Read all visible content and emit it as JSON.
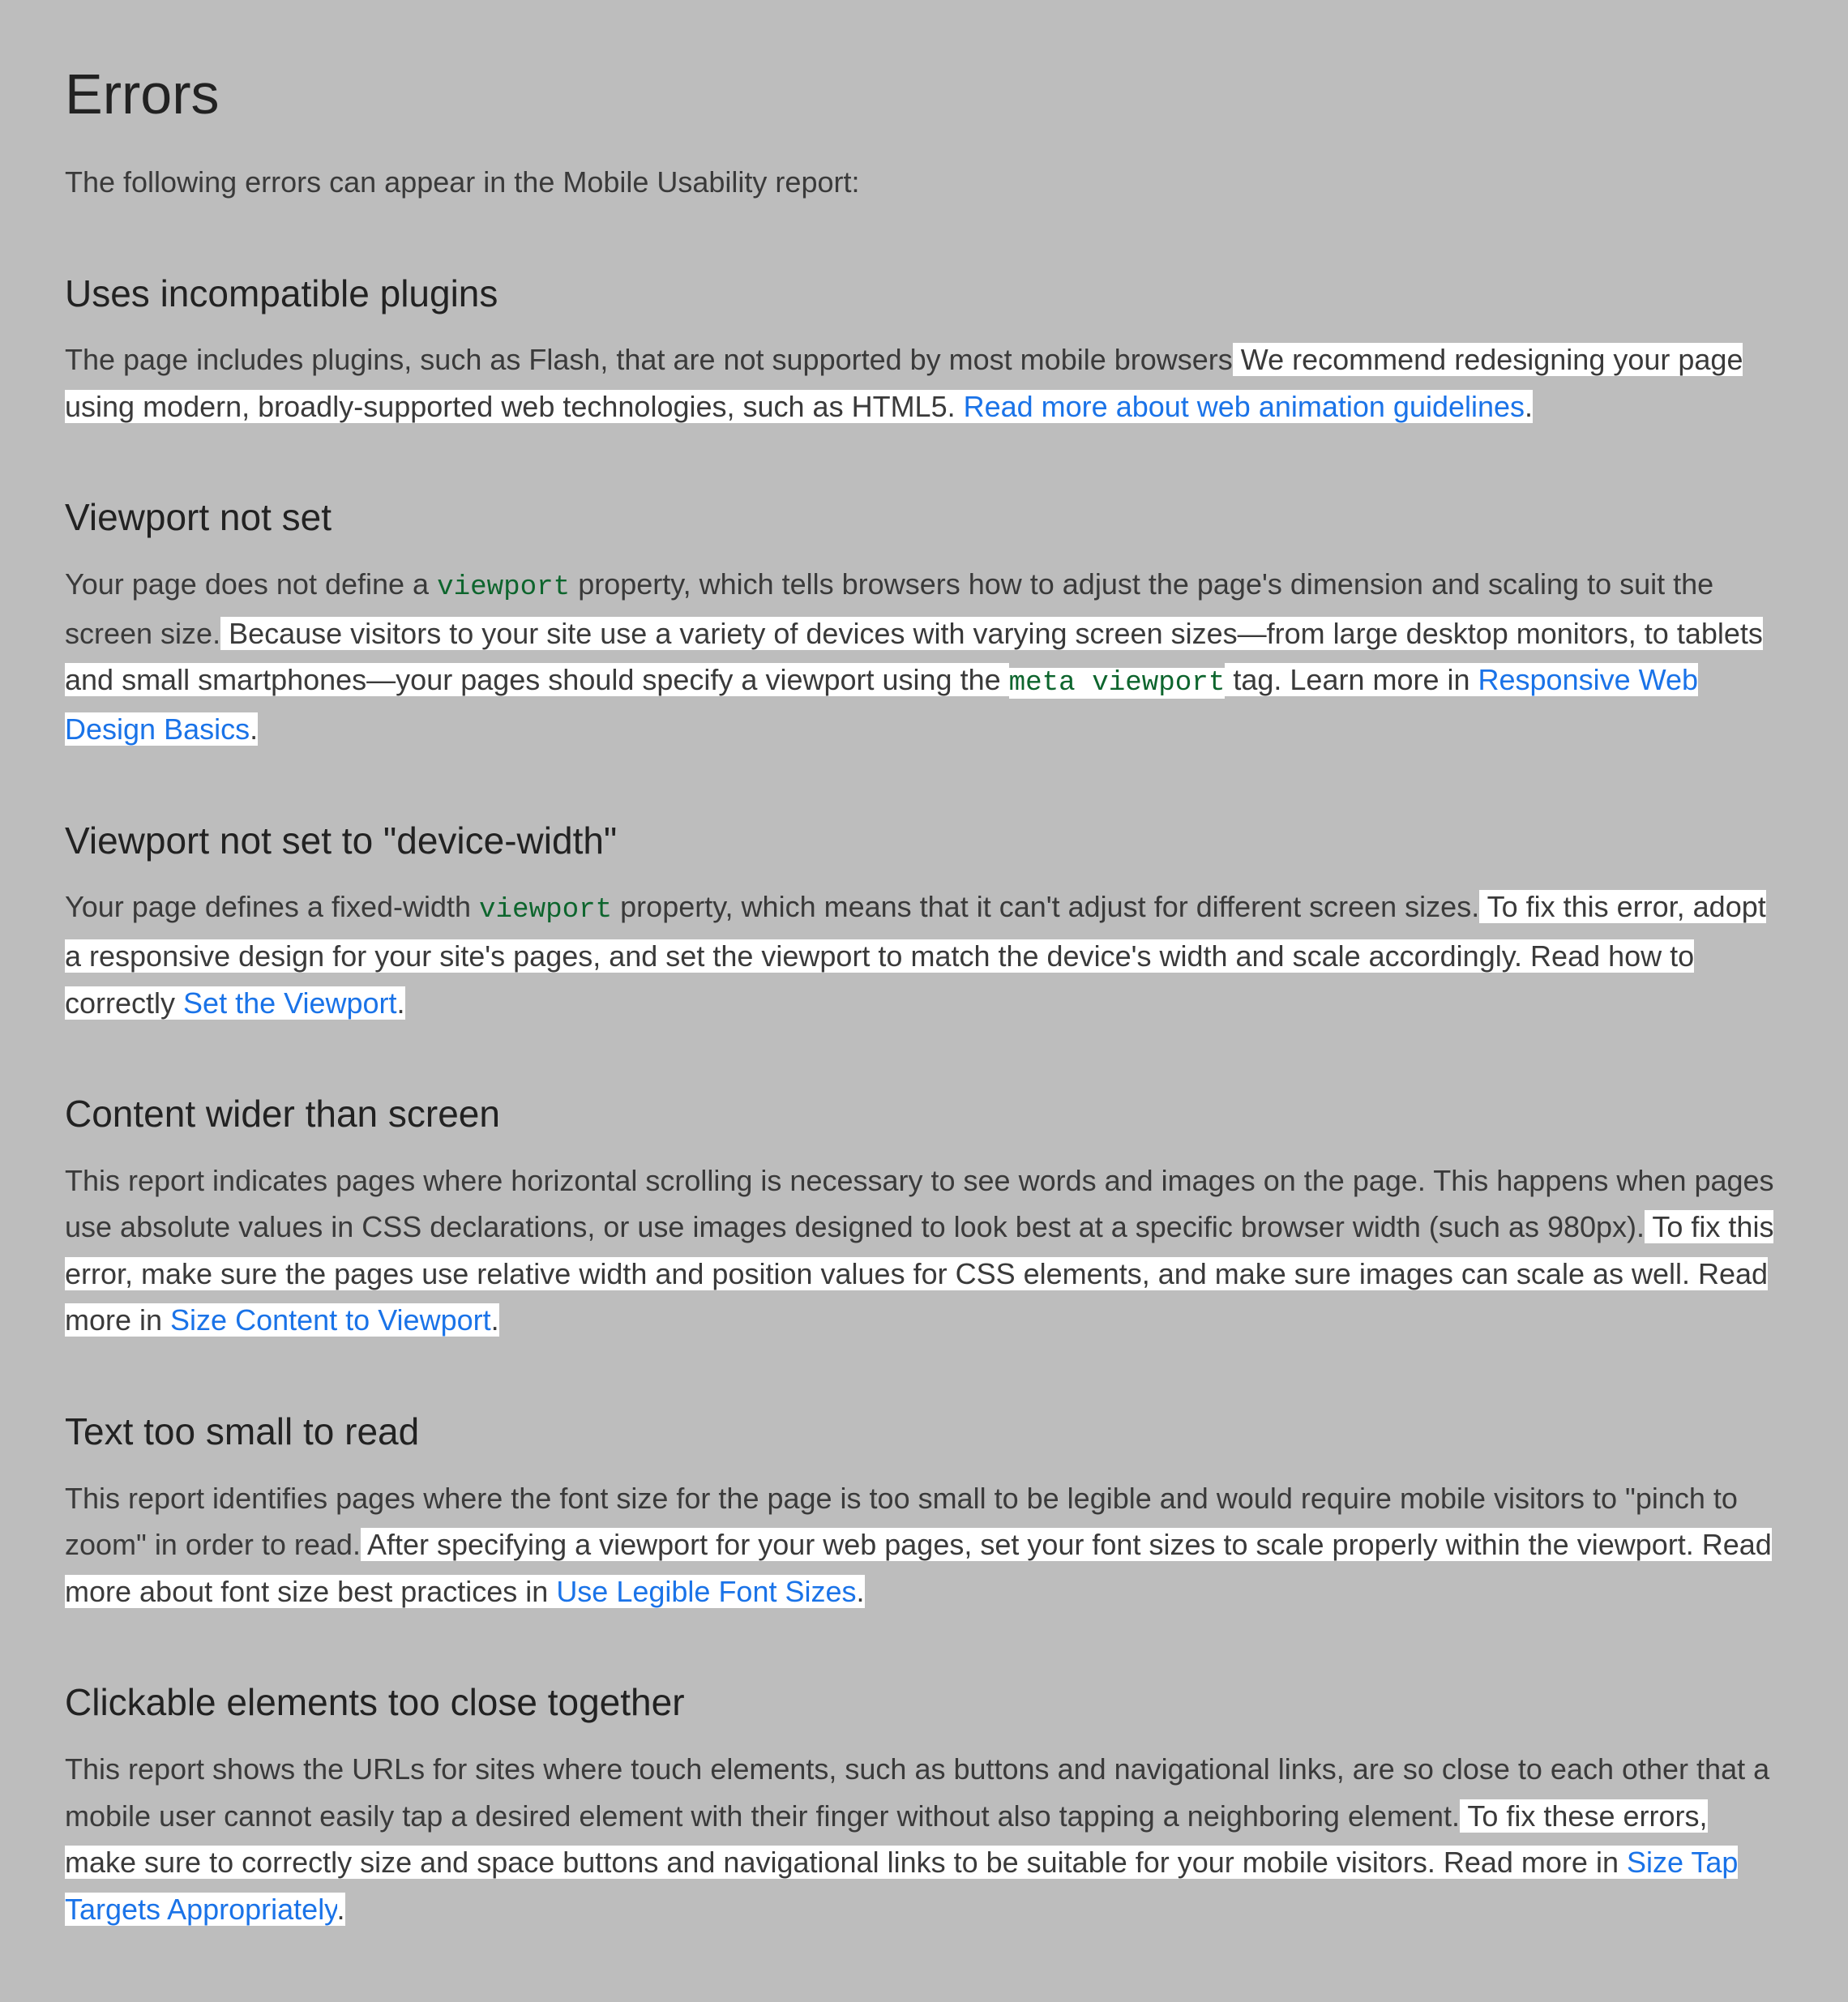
{
  "title": "Errors",
  "intro": "The following errors can appear in the Mobile Usability report:",
  "sections": [
    {
      "heading": "Uses incompatible plugins",
      "parts": [
        {
          "t": "text",
          "v": "The page includes plugins, such as Flash, that are not supported by most mobile browsers"
        },
        {
          "t": "hl",
          "v": " We recommend redesigning your page using modern, broadly-supported web technologies, such as HTML5. "
        },
        {
          "t": "hl-link",
          "v": "Read more about web animation guidelines"
        },
        {
          "t": "hl",
          "v": "."
        }
      ]
    },
    {
      "heading": "Viewport not set",
      "parts": [
        {
          "t": "text",
          "v": "Your page does not define a "
        },
        {
          "t": "code",
          "v": "viewport"
        },
        {
          "t": "text",
          "v": " property, which tells browsers how to adjust the page's dimension and scaling to suit the screen size."
        },
        {
          "t": "hl",
          "v": " Because visitors to your site use a variety of devices with varying screen sizes—from large desktop monitors, to tablets and small smartphones—your pages should specify a viewport using the "
        },
        {
          "t": "hl-code",
          "v": "meta viewport"
        },
        {
          "t": "hl",
          "v": " tag. Learn more in "
        },
        {
          "t": "hl-link",
          "v": "Responsive Web Design Basics"
        },
        {
          "t": "hl",
          "v": "."
        }
      ]
    },
    {
      "heading": "Viewport not set to \"device-width\"",
      "parts": [
        {
          "t": "text",
          "v": "Your page defines a fixed-width "
        },
        {
          "t": "code",
          "v": "viewport"
        },
        {
          "t": "text",
          "v": " property, which means that it can't adjust for different screen sizes."
        },
        {
          "t": "hl",
          "v": " To fix this error, adopt a responsive design for your site's pages, and set the viewport to match the device's width and scale accordingly. Read how to correctly "
        },
        {
          "t": "hl-link",
          "v": "Set the Viewport"
        },
        {
          "t": "hl",
          "v": "."
        }
      ]
    },
    {
      "heading": "Content wider than screen",
      "parts": [
        {
          "t": "text",
          "v": "This report indicates pages where horizontal scrolling is necessary to see words and images on the page. This happens when pages use absolute values in CSS declarations, or use images designed to look best at a specific browser width (such as 980px)."
        },
        {
          "t": "hl",
          "v": " To fix this error, make sure the pages use relative width and position values for CSS elements, and make sure images can scale as well. Read more in "
        },
        {
          "t": "hl-link",
          "v": "Size Content to Viewport"
        },
        {
          "t": "hl",
          "v": "."
        }
      ]
    },
    {
      "heading": "Text too small to read",
      "parts": [
        {
          "t": "text",
          "v": "This report identifies pages where the font size for the page is too small to be legible and would require mobile visitors to \"pinch to zoom\" in order to read."
        },
        {
          "t": "hl",
          "v": " After specifying a viewport for your web pages, set your font sizes to scale properly within the viewport. Read more about font size best practices in "
        },
        {
          "t": "hl-link",
          "v": "Use Legible Font Sizes"
        },
        {
          "t": "hl",
          "v": "."
        }
      ]
    },
    {
      "heading": "Clickable elements too close together",
      "parts": [
        {
          "t": "text",
          "v": "This report shows the URLs for sites where touch elements, such as buttons and navigational links, are so close to each other that a mobile user cannot easily tap a desired element with their finger without also tapping a neighboring element."
        },
        {
          "t": "hl",
          "v": " To fix these errors, make sure to correctly size and space buttons and navigational links to be suitable for your mobile visitors. Read more in "
        },
        {
          "t": "hl-link",
          "v": "Size Tap Targets Appropriately"
        },
        {
          "t": "hl",
          "v": "."
        }
      ]
    }
  ]
}
